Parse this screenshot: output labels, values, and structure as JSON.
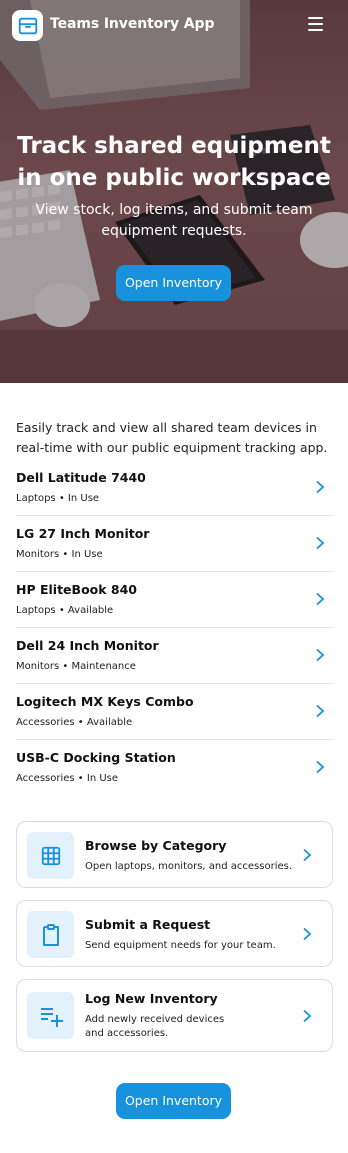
{
  "app": {
    "title": "Teams Inventory App"
  },
  "hero": {
    "title_line1": "Track shared equipment",
    "title_line2": "in one public workspace",
    "subtitle": "View stock, log items, and submit team equipment requests.",
    "button_label": "Open Inventory"
  },
  "intro": {
    "text": "Easily track and view all shared team devices in real-time with our public equipment tracking app."
  },
  "inventory": {
    "items": [
      {
        "name": "Dell Latitude 7440",
        "category": "Laptops",
        "status": "In Use"
      },
      {
        "name": "LG 27 Inch Monitor",
        "category": "Monitors",
        "status": "In Use"
      },
      {
        "name": "HP EliteBook 840",
        "category": "Laptops",
        "status": "Available"
      },
      {
        "name": "Dell 24 Inch Monitor",
        "category": "Monitors",
        "status": "Maintenance"
      },
      {
        "name": "Logitech MX Keys Combo",
        "category": "Accessories",
        "status": "Available"
      },
      {
        "name": "USB-C Docking Station",
        "category": "Accessories",
        "status": "In Use"
      }
    ]
  },
  "cards": {
    "browse": {
      "title": "Browse by Category",
      "desc": "Open laptops, monitors, and accessories.",
      "icon": "grid-icon"
    },
    "request": {
      "title": "Submit a Request",
      "desc": "Send equipment needs for your team.",
      "icon": "clipboard-icon"
    },
    "log": {
      "title": "Log New Inventory",
      "desc_line1": "Add newly received devices",
      "desc_line2": "and accessories.",
      "icon": "list-add-icon"
    }
  },
  "footer": {
    "button_label": "Open Inventory"
  },
  "colors": {
    "accent": "#1992dd",
    "icon_bg": "#e3f1fa",
    "hero_tint": "#7a5356"
  }
}
